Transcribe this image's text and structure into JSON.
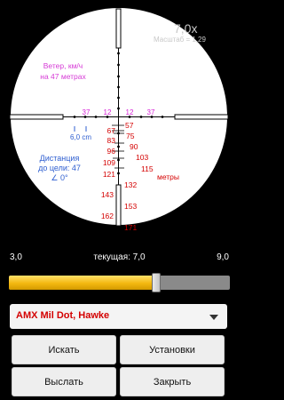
{
  "scope": {
    "zoom": "7,0x",
    "scale_label": "Масштаб = 1,29",
    "wind_line1": "Ветер, км/ч",
    "wind_line2": "на 47 метрах",
    "top_marks": [
      "37",
      "12",
      "12",
      "37"
    ],
    "spread": "6,0 cm",
    "distance_line1": "Дистанция",
    "distance_line2": "до цели: 47",
    "distance_line3": "∠ 0°",
    "drop_values": [
      "57",
      "67",
      "75",
      "83",
      "90",
      "96",
      "103",
      "109",
      "115",
      "121",
      "132",
      "143",
      "153",
      "162",
      "171"
    ],
    "meters_label": "метры"
  },
  "zoom_bar": {
    "min": "3,0",
    "current": "текущая: 7,0",
    "max": "9,0",
    "fraction": 0.666
  },
  "reticle_select": {
    "value": "AMX Mil Dot, Hawke"
  },
  "buttons": {
    "search": "Искать",
    "settings": "Установки",
    "send": "Выслать",
    "close": "Закрыть"
  },
  "colors": {
    "wind": "#d63ad6",
    "marks": "#d61fd6",
    "blue": "#2f5fd0",
    "red": "#d40000",
    "reticle": "#000000",
    "accent": "#f3b80f"
  }
}
